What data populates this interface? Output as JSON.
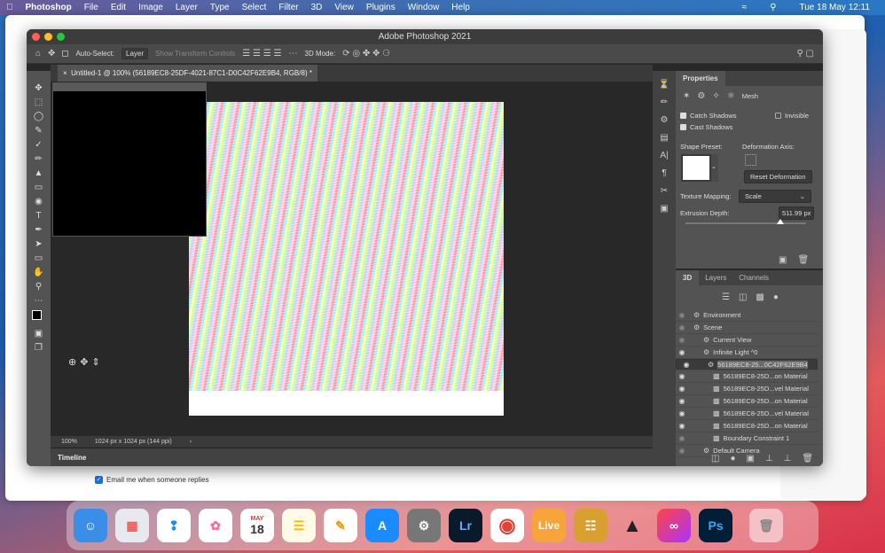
{
  "menubar": {
    "app": "Photoshop",
    "items": [
      "File",
      "Edit",
      "Image",
      "Layer",
      "Type",
      "Select",
      "Filter",
      "3D",
      "View",
      "Plugins",
      "Window",
      "Help"
    ],
    "clock": "Tue 18 May  12:11"
  },
  "browser": {
    "email_label": "Email me when someone replies",
    "email_checked": true
  },
  "window": {
    "title": "Adobe Photoshop 2021"
  },
  "options": {
    "auto_select": "Auto-Select:",
    "layer_value": "Layer",
    "show_transform": "Show Transform Controls",
    "mode_3d": "3D Mode:"
  },
  "document": {
    "tab": "Untitled-1 @ 100% (56189EC8-25DF-4021-87C1-D0C42F62E9B4, RGB/8) *",
    "zoom": "100%",
    "size": "1024 px x 1024 px (144 ppi)"
  },
  "timeline": {
    "label": "Timeline"
  },
  "properties": {
    "title": "Properties",
    "mesh": "Mesh",
    "catch_shadows": "Catch Shadows",
    "catch_checked": true,
    "invisible": "Invisible",
    "invisible_checked": false,
    "cast_shadows": "Cast Shadows",
    "cast_checked": true,
    "shape_preset": "Shape Preset:",
    "deformation_axis": "Deformation Axis:",
    "reset": "Reset Deformation",
    "texture_mapping": "Texture Mapping:",
    "texture_value": "Scale",
    "extrusion_depth": "Extrusion Depth:",
    "extrusion_value": "511.99 px",
    "extrusion_slider_percent": 79
  },
  "panel3d": {
    "tabs": [
      "3D",
      "Layers",
      "Channels"
    ],
    "items": [
      {
        "label": "Environment",
        "indent": 0,
        "visible": false
      },
      {
        "label": "Scene",
        "indent": 0,
        "visible": false
      },
      {
        "label": "Current View",
        "indent": 1,
        "visible": false
      },
      {
        "label": "Infinite Light ^0",
        "indent": 1,
        "visible": true
      },
      {
        "label": "56189EC8-25...0C42F62E9B4",
        "indent": 1,
        "visible": true,
        "selected": true
      },
      {
        "label": "56189EC8-25D...on Material",
        "indent": 2,
        "visible": true
      },
      {
        "label": "56189EC8-25D...vel Material",
        "indent": 2,
        "visible": true
      },
      {
        "label": "56189EC8-25D...on Material",
        "indent": 2,
        "visible": true
      },
      {
        "label": "56189EC8-25D...vel Material",
        "indent": 2,
        "visible": true
      },
      {
        "label": "56189EC8-25D...on Material",
        "indent": 2,
        "visible": true
      },
      {
        "label": "Boundary Constraint 1",
        "indent": 2,
        "visible": false
      },
      {
        "label": "Default Camera",
        "indent": 1,
        "visible": false
      }
    ]
  },
  "dock": {
    "calendar_month": "MAY",
    "calendar_day": "18",
    "lightroom": "Lr",
    "live": "Live",
    "photoshop": "Ps"
  }
}
